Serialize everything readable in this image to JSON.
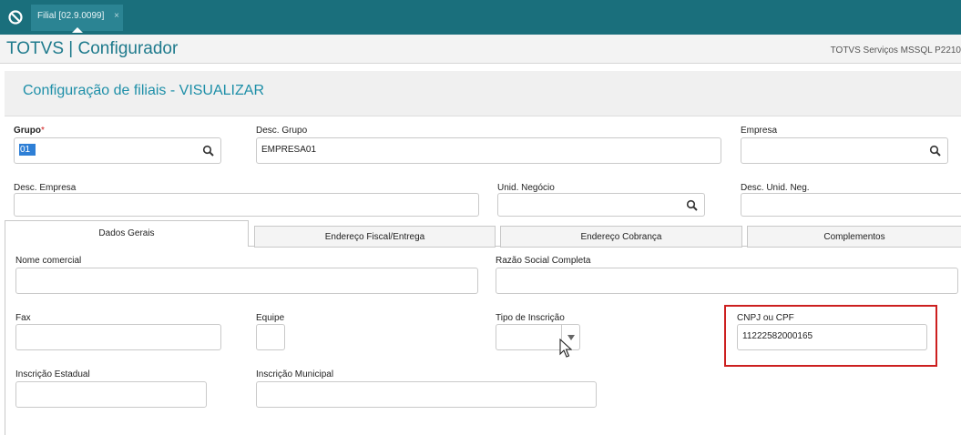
{
  "window": {
    "tab_label": "Filial [02.9.0099]",
    "tab_close": "×"
  },
  "header": {
    "app_title": "TOTVS | Configurador",
    "server_info": "TOTVS Serviços MSSQL P2210"
  },
  "page": {
    "title": "Configuração de filiais - VISUALIZAR"
  },
  "form": {
    "grupo": {
      "label": "Grupo",
      "required_mark": "*",
      "value": "01"
    },
    "desc_grupo": {
      "label": "Desc. Grupo",
      "value": "EMPRESA01"
    },
    "empresa": {
      "label": "Empresa",
      "value": ""
    },
    "desc_empresa": {
      "label": "Desc. Empresa",
      "value": ""
    },
    "unid_negocio": {
      "label": "Unid. Negócio",
      "value": ""
    },
    "desc_unid_neg": {
      "label": "Desc. Unid. Neg.",
      "value": ""
    }
  },
  "tabs": [
    {
      "label": "Dados Gerais",
      "active": true
    },
    {
      "label": "Endereço Fiscal/Entrega",
      "active": false
    },
    {
      "label": "Endereço Cobrança",
      "active": false
    },
    {
      "label": "Complementos",
      "active": false
    }
  ],
  "dados_gerais": {
    "nome_comercial": {
      "label": "Nome comercial",
      "value": ""
    },
    "razao_social": {
      "label": "Razão Social Completa",
      "value": ""
    },
    "fax": {
      "label": "Fax",
      "value": ""
    },
    "equipe": {
      "label": "Equipe",
      "value": ""
    },
    "tipo_inscricao": {
      "label": "Tipo de Inscrição",
      "value": ""
    },
    "cnpj_cpf": {
      "label": "CNPJ ou CPF",
      "value": "11222582000165"
    },
    "inscricao_estadual": {
      "label": "Inscrição Estadual",
      "value": ""
    },
    "inscricao_municipal": {
      "label": "Inscrição Municipal",
      "value": ""
    }
  },
  "colors": {
    "topbar": "#1a6f7c",
    "accent": "#1e8fa8",
    "highlight_box": "#cc1f1f",
    "selection": "#2e7fd6"
  },
  "icons": {
    "app_logo": "totvs-logo-icon",
    "lookup": "magnifier-icon",
    "dropdown": "chevron-down-icon"
  }
}
